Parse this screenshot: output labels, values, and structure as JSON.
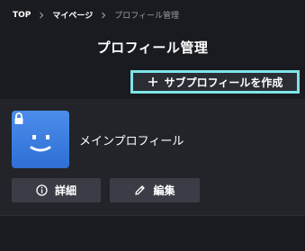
{
  "breadcrumb": {
    "items": [
      {
        "label": "TOP"
      },
      {
        "label": "マイページ"
      },
      {
        "label": "プロフィール管理"
      }
    ]
  },
  "header": {
    "title": "プロフィール管理"
  },
  "toolbar": {
    "create_label": "サブプロフィールを作成"
  },
  "profile": {
    "name": "メインプロフィール",
    "avatar_icon": "smiley-face-icon",
    "locked": true
  },
  "actions": {
    "detail_label": "詳細",
    "edit_label": "編集"
  },
  "colors": {
    "background": "#1a1b20",
    "panel": "#22242a",
    "highlight": "#7ee4e6",
    "avatar": "#3f82e4",
    "button": "#3b3d46"
  }
}
